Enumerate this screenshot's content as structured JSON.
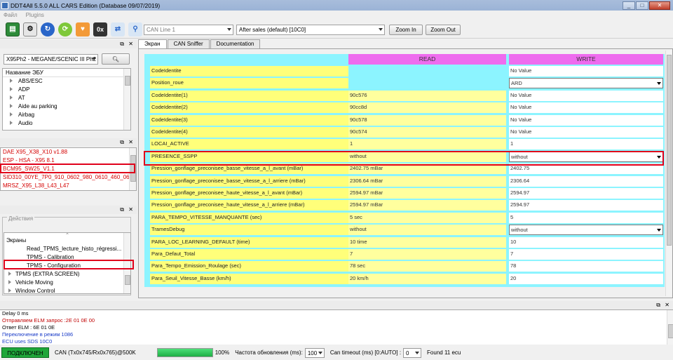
{
  "window": {
    "title": "DDT4All 5.5.0 ALL CARS Edition (Database 09/07/2019)"
  },
  "menu": [
    "Файл",
    "Plugins"
  ],
  "toolbar": {
    "can_line": "CAN Line 1",
    "session": "After sales (default) [10C0]",
    "zoom_in": "Zoom In",
    "zoom_out": "Zoom Out",
    "icons": [
      "ecu-scan-icon",
      "dump-icon",
      "refresh-icon",
      "connect-icon",
      "health-icon",
      "hex-icon",
      "sniffer-icon",
      "network-icon"
    ]
  },
  "left": {
    "vehicle_select": "X95Ph2 - MEGANE/SCENIC III Ph2",
    "tree_header": "Название ЭБУ",
    "ecu_categories": [
      "ABS/ESC",
      "ADP",
      "AT",
      "Aide au parking",
      "Airbag",
      "Audio"
    ],
    "ecu_files": [
      "DAE X95_X38_X10 v1.88",
      "ESP - HSA - X95 8.1",
      "BCM95_SW25_V1.1",
      "SID310_00YE_7P0_910_0602_980_0610_460_0603_",
      "MRSZ_X95_L38_L43_L47"
    ],
    "actions_label": "Действия",
    "screens": {
      "header": "Экраны",
      "items": [
        {
          "label": "Read_TPMS_lecture_histo_régressi...",
          "indent": true
        },
        {
          "label": "TPMS - Calibration",
          "indent": true
        },
        {
          "label": "TPMS - Configuration",
          "indent": true
        },
        {
          "label": "TPMS (EXTRA SCREEN)",
          "indent": false
        },
        {
          "label": "Vehicle Moving",
          "indent": false
        },
        {
          "label": "Window Control",
          "indent": false
        }
      ]
    }
  },
  "tabs": [
    "Экран",
    "CAN Sniffer",
    "Documentation"
  ],
  "grid": {
    "read_header": "READ",
    "write_header": "WRITE",
    "rows": [
      {
        "label": "CodeIdentite",
        "read": "",
        "write": "No Value",
        "combo": false
      },
      {
        "label": "Position_roue",
        "read": "",
        "write": "ARD",
        "combo": true
      },
      {
        "label": "CodeIdentite(1)",
        "read": "90c576",
        "write": "No Value",
        "combo": false
      },
      {
        "label": "CodeIdentite(2)",
        "read": "90cc8d",
        "write": "No Value",
        "combo": false
      },
      {
        "label": "CodeIdentite(3)",
        "read": "90c578",
        "write": "No Value",
        "combo": false
      },
      {
        "label": "CodeIdentite(4)",
        "read": "90c574",
        "write": "No Value",
        "combo": false
      },
      {
        "label": "LOCAI_ACTIVE",
        "read": "1",
        "write": "1",
        "combo": false
      },
      {
        "label": "PRESENCE_SSPP",
        "read": "without",
        "write": "without",
        "combo": true
      },
      {
        "label": "Pression_gonflage_preconisee_basse_vitesse_a_l_avant (mBar)",
        "read": "2402.75 mBar",
        "write": "2402.75",
        "combo": false
      },
      {
        "label": "Pression_gonflage_preconisee_basse_vitesse_a_l_arriere (mBar)",
        "read": "2306.64 mBar",
        "write": "2306.64",
        "combo": false
      },
      {
        "label": "Pression_gonflage_preconisee_haute_vitesse_a_l_avant (mBar)",
        "read": "2594.97 mBar",
        "write": "2594.97",
        "combo": false
      },
      {
        "label": "Pression_gonflage_preconisee_haute_vitesse_a_l_arriere (mBar)",
        "read": "2594.97 mBar",
        "write": "2594.97",
        "combo": false
      },
      {
        "label": "PARA_TEMPO_VITESSE_MANQUANTE (sec)",
        "read": "5 sec",
        "write": "5",
        "combo": false
      },
      {
        "label": "TramesDebug",
        "read": "without",
        "write": "without",
        "combo": true
      },
      {
        "label": "PARA_LOC_LEARNING_DEFAULT (time)",
        "read": "10 time",
        "write": "10",
        "combo": false
      },
      {
        "label": "Para_Defaut_Total",
        "read": "7",
        "write": "7",
        "combo": false
      },
      {
        "label": "Para_Tempo_Emission_Roulage (sec)",
        "read": "78 sec",
        "write": "78",
        "combo": false
      },
      {
        "label": "Para_Seuil_Vitesse_Basse (km/h)",
        "read": "20 km/h",
        "write": "20",
        "combo": false
      }
    ]
  },
  "log": [
    {
      "text": "Delay 0 ms",
      "color": "#000000"
    },
    {
      "text": "Отправляем ELM запрос :2E 01 0E 00",
      "color": "#c00000"
    },
    {
      "text": "Ответ ELM : 6E 01 0E",
      "color": "#000000"
    },
    {
      "text": "Переключение в режим 1086",
      "color": "#1a3cc8"
    },
    {
      "text": "ECU uses SDS 10C0",
      "color": "#1a3cc8"
    }
  ],
  "status": {
    "connection": "ПОДКЛЮЧЕН",
    "can_info": "CAN (Tx0x745/Rx0x765)@500K",
    "progress_percent": 100,
    "progress_label": "100%",
    "refresh_label": "Частота обновления (ms):",
    "refresh_value": "100",
    "timeout_label": "Can timeout (ms) [0:AUTO] :",
    "timeout_value": "0",
    "found": "Found 11 ecu"
  }
}
